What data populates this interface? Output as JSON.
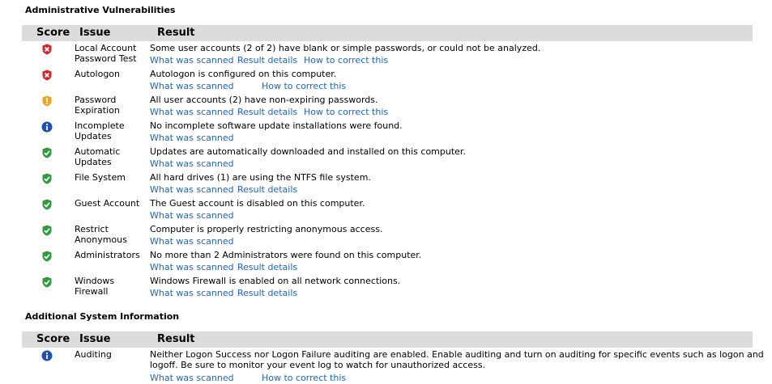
{
  "sections": {
    "admin_title": "Administrative Vulnerabilities",
    "info_title": "Additional System Information"
  },
  "columns": {
    "score": "Score",
    "issue": "Issue",
    "result": "Result"
  },
  "admin_rows": [
    {
      "icon": "error-icon",
      "issue": "Local Account Password Test",
      "result": "Some user accounts (2 of 2) have blank or simple passwords, or could not be analyzed.",
      "links": [
        "What was scanned",
        "Result details",
        "How to correct this"
      ]
    },
    {
      "icon": "error-icon",
      "issue": "Autologon",
      "result": "Autologon is configured on this computer.",
      "links": [
        "What was scanned",
        "How to correct this"
      ]
    },
    {
      "icon": "warning-shield-icon",
      "issue": "Password Expiration",
      "result": "All user accounts (2) have non-expiring passwords.",
      "links": [
        "What was scanned",
        "Result details",
        "How to correct this"
      ]
    },
    {
      "icon": "info-icon",
      "issue": "Incomplete Updates",
      "result": "No incomplete software update installations were found.",
      "links": [
        "What was scanned"
      ]
    },
    {
      "icon": "check-shield-icon",
      "issue": "Automatic Updates",
      "result": "Updates are automatically downloaded and installed on this computer.",
      "links": [
        "What was scanned"
      ]
    },
    {
      "icon": "check-shield-icon",
      "issue": "File System",
      "result": "All hard drives (1) are using the NTFS file system.",
      "links": [
        "What was scanned",
        "Result details"
      ]
    },
    {
      "icon": "check-shield-icon",
      "issue": "Guest Account",
      "result": "The Guest account is disabled on this computer.",
      "links": [
        "What was scanned"
      ]
    },
    {
      "icon": "check-shield-icon",
      "issue": "Restrict Anonymous",
      "result": "Computer is properly restricting anonymous access.",
      "links": [
        "What was scanned"
      ]
    },
    {
      "icon": "check-shield-icon",
      "issue": "Administrators",
      "result": "No more than 2 Administrators were found on this computer.",
      "links": [
        "What was scanned",
        "Result details"
      ]
    },
    {
      "icon": "check-shield-icon",
      "issue": "Windows Firewall",
      "result": "Windows Firewall is enabled on all network connections.",
      "links": [
        "What was scanned",
        "Result details"
      ]
    }
  ],
  "info_rows": [
    {
      "icon": "info-icon",
      "issue": "Auditing",
      "result": "Neither Logon Success nor Logon Failure auditing are enabled. Enable auditing and turn on auditing for specific events such as logon and logoff. Be sure to monitor your event log to watch for unauthorized access.",
      "links": [
        "What was scanned",
        "How to correct this"
      ]
    }
  ],
  "colors": {
    "link": "#1e64c8",
    "header_bg": "#dcdcdc",
    "error": "#d8262a",
    "warning": "#f2a51a",
    "ok": "#2e9b3c",
    "info": "#1f4fb5"
  }
}
